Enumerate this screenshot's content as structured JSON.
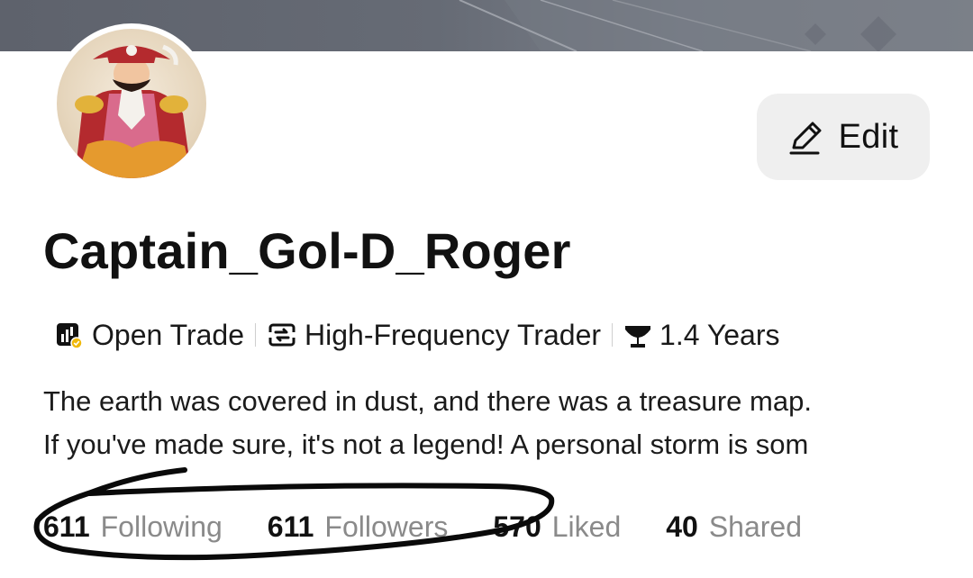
{
  "profile": {
    "username": "Captain_Gol-D_Roger",
    "edit_label": "Edit",
    "tags": [
      {
        "icon": "open-trade-icon",
        "label": "Open Trade"
      },
      {
        "icon": "swap-arrows-icon",
        "label": "High-Frequency Trader"
      },
      {
        "icon": "trophy-icon",
        "label": "1.4 Years"
      }
    ],
    "bio_lines": [
      "The earth was covered in dust, and there was a treasure map.",
      "If you've made sure, it's not a legend! A personal storm is som"
    ]
  },
  "stats": [
    {
      "value": "611",
      "label": "Following"
    },
    {
      "value": "611",
      "label": "Followers"
    },
    {
      "value": "570",
      "label": "Liked"
    },
    {
      "value": "40",
      "label": "Shared"
    }
  ],
  "colors": {
    "banner": "#666b75",
    "edit_button_bg": "#efefef",
    "stat_label": "#8a8a8a",
    "open_trade_badge": "#f0b90b",
    "avatar_hat": "#b42a2e",
    "avatar_shirt": "#d96b8c"
  }
}
